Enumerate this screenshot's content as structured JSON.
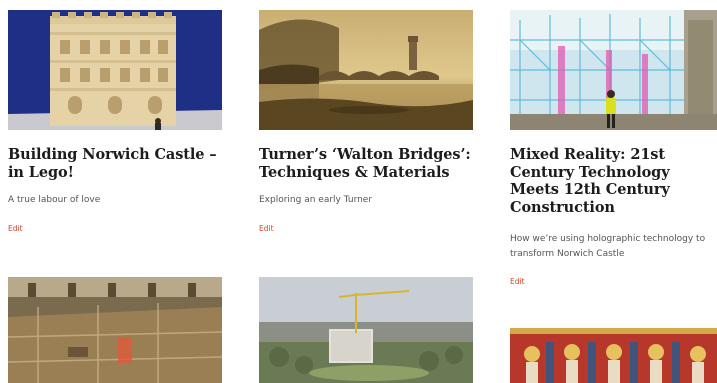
{
  "colors": {
    "title": "#1c1c1c",
    "description": "#555555",
    "edit_link": "#d2452b",
    "background": "#ffffff"
  },
  "cards": [
    {
      "title": "Building Norwich Castle – in Lego!",
      "description": "A true labour of love",
      "edit": "Edit"
    },
    {
      "title": "Turner’s ‘Walton Bridges’: Techniques & Materials",
      "description": "Exploring an early Turner",
      "edit": "Edit"
    },
    {
      "title": "Mixed Reality: 21st Century Technology Meets 12th Century Construction",
      "description": "How we’re using holographic technology to transform Norwich Castle",
      "edit": "Edit"
    }
  ]
}
